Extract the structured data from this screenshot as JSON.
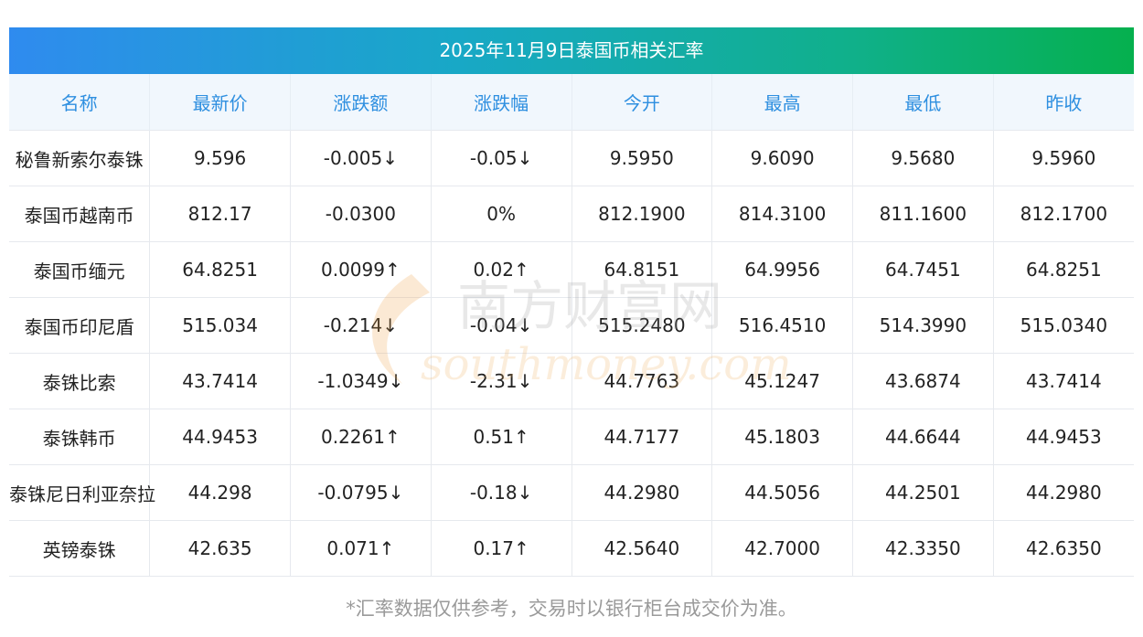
{
  "title": "2025年11月9日泰国币相关汇率",
  "columns": [
    "名称",
    "最新价",
    "涨跌额",
    "涨跌幅",
    "今开",
    "最高",
    "最低",
    "昨收"
  ],
  "rows": [
    {
      "name": "秘鲁新索尔泰铢",
      "latest": "9.596",
      "change": "-0.005↓",
      "pct": "-0.05↓",
      "open": "9.5950",
      "high": "9.6090",
      "low": "9.5680",
      "prev": "9.5960",
      "trend": "down"
    },
    {
      "name": "泰国币越南币",
      "latest": "812.17",
      "change": "-0.0300",
      "pct": "0%",
      "open": "812.1900",
      "high": "814.3100",
      "low": "811.1600",
      "prev": "812.1700",
      "trend": "flat"
    },
    {
      "name": "泰国币缅元",
      "latest": "64.8251",
      "change": "0.0099↑",
      "pct": "0.02↑",
      "open": "64.8151",
      "high": "64.9956",
      "low": "64.7451",
      "prev": "64.8251",
      "trend": "up"
    },
    {
      "name": "泰国币印尼盾",
      "latest": "515.034",
      "change": "-0.214↓",
      "pct": "-0.04↓",
      "open": "515.2480",
      "high": "516.4510",
      "low": "514.3990",
      "prev": "515.0340",
      "trend": "down"
    },
    {
      "name": "泰铢比索",
      "latest": "43.7414",
      "change": "-1.0349↓",
      "pct": "-2.31↓",
      "open": "44.7763",
      "high": "45.1247",
      "low": "43.6874",
      "prev": "43.7414",
      "trend": "down"
    },
    {
      "name": "泰铢韩币",
      "latest": "44.9453",
      "change": "0.2261↑",
      "pct": "0.51↑",
      "open": "44.7177",
      "high": "45.1803",
      "low": "44.6644",
      "prev": "44.9453",
      "trend": "up"
    },
    {
      "name": "泰铢尼日利亚奈拉",
      "latest": "44.298",
      "change": "-0.0795↓",
      "pct": "-0.18↓",
      "open": "44.2980",
      "high": "44.5056",
      "low": "44.2501",
      "prev": "44.2980",
      "trend": "down"
    },
    {
      "name": "英镑泰铢",
      "latest": "42.635",
      "change": "0.071↑",
      "pct": "0.17↑",
      "open": "42.5640",
      "high": "42.7000",
      "low": "42.3350",
      "prev": "42.6350",
      "trend": "up"
    }
  ],
  "footnote": "*汇率数据仅供参考，交易时以银行柜台成交价为准。",
  "watermark": {
    "text_cn": "南方财富网",
    "text_en": "southmoney.com"
  },
  "colors": {
    "up": "#e8211e",
    "down": "#1c8a2c",
    "header_text": "#2e8fe0",
    "header_bg": "#f1f7fd"
  }
}
